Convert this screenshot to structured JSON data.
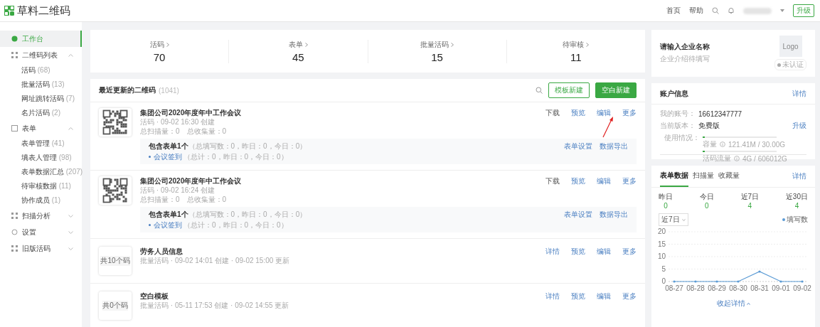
{
  "header": {
    "brand": "草料二维码",
    "nav": [
      "首页",
      "帮助"
    ],
    "upgrade": "升级"
  },
  "sidebar": {
    "items": [
      {
        "label": "工作台",
        "selected": true
      },
      {
        "label": "二维码列表",
        "selected": false,
        "expanded": true,
        "children": [
          {
            "label": "活码",
            "count": "(68)"
          },
          {
            "label": "批量活码",
            "count": "(13)"
          },
          {
            "label": "网址跳转活码",
            "count": "(7)"
          },
          {
            "label": "名片活码",
            "count": "(2)"
          }
        ]
      },
      {
        "label": "表单",
        "selected": false,
        "expanded": true,
        "children": [
          {
            "label": "表单管理",
            "count": "(41)"
          },
          {
            "label": "填表人管理",
            "count": "(98)"
          },
          {
            "label": "表单数据汇总",
            "count": "(207)"
          },
          {
            "label": "待审核数据",
            "count": "(11)"
          },
          {
            "label": "协作成员",
            "count": "(1)"
          }
        ]
      },
      {
        "label": "扫描分析",
        "selected": false,
        "expanded": false
      },
      {
        "label": "设置",
        "selected": false,
        "expanded": false
      },
      {
        "label": "旧版活码",
        "selected": false,
        "expanded": false
      }
    ]
  },
  "stats": [
    {
      "label": "活码",
      "value": "70"
    },
    {
      "label": "表单",
      "value": "45"
    },
    {
      "label": "批量活码",
      "value": "15"
    },
    {
      "label": "待审核",
      "value": "11"
    }
  ],
  "recent": {
    "title": "最近更新的二维码",
    "count": "(1041)",
    "buttons": [
      "模板新建",
      "空白新建"
    ],
    "items": [
      {
        "kind": "qr",
        "title": "集团公司2020年度年中工作会议",
        "meta": "活码 · 09-02 16:30 创建",
        "counts": "总扫描量：0　总收集量：0",
        "actions": [
          "下载",
          "预览",
          "编辑",
          "更多"
        ],
        "summary": {
          "heading": "包含表单1个",
          "stats": "（总填写数：0，昨日：0，今日：0）",
          "forms": [
            {
              "name": "会议签到",
              "stats": "（总计：0，昨日：0，今日：0）"
            }
          ],
          "actions": [
            "表单设置",
            "数据导出"
          ]
        }
      },
      {
        "kind": "qr",
        "title": "集团公司2020年度年中工作会议",
        "meta": "活码 · 09-02 16:24 创建",
        "counts": "总扫描量：0　总收集量：0",
        "actions": [
          "下载",
          "预览",
          "编辑",
          "更多"
        ],
        "summary": {
          "heading": "包含表单1个",
          "stats": "（总填写数：0，昨日：0，今日：0）",
          "forms": [
            {
              "name": "会议签到",
              "stats": "（总计：0，昨日：0，今日：0）"
            }
          ],
          "actions": [
            "表单设置",
            "数据导出"
          ]
        }
      },
      {
        "kind": "batch",
        "thumb": "共10个码",
        "title": "劳务人员信息",
        "meta": "批量活码 · 09-02 14:01 创建 · 09-02 15:00 更新",
        "actions": [
          "详情",
          "预览",
          "编辑",
          "更多"
        ]
      },
      {
        "kind": "batch",
        "thumb": "共0个码",
        "title": "空白模板",
        "meta": "批量活码 · 05-11 17:53 创建 · 09-02 14:55 更新",
        "actions": [
          "详情",
          "预览",
          "编辑",
          "更多"
        ]
      }
    ]
  },
  "company": {
    "name": "请输入企业名称",
    "intro": "企业介绍待填写",
    "logo": "Logo",
    "badge": "未认证"
  },
  "account": {
    "title": "账户信息",
    "link": "详情",
    "rows": [
      {
        "label": "我的账号：",
        "value": "16612347777"
      },
      {
        "label": "当前版本：",
        "value": "免费版",
        "action": "升级"
      }
    ],
    "usage_label": "使用情况：",
    "usage": [
      {
        "name": "容量",
        "reading": "121.41M / 30.00G",
        "level": 0.03
      },
      {
        "name": "活码流量",
        "reading": "4G / 606012G",
        "level": 0.03
      }
    ]
  },
  "data_card": {
    "tabs": [
      {
        "label": "表单数据",
        "selected": true
      },
      {
        "label": "扫描量",
        "selected": false
      },
      {
        "label": "收藏量",
        "selected": false
      }
    ],
    "link": "详情",
    "summary": [
      {
        "label": "昨日",
        "value": "0"
      },
      {
        "label": "今日",
        "value": "0"
      },
      {
        "label": "近7日",
        "value": "4"
      },
      {
        "label": "近30日",
        "value": "4"
      }
    ],
    "range": "近7日",
    "collapse": "收起详情",
    "chart_data": {
      "type": "line",
      "categories": [
        "08-27",
        "08-28",
        "08-29",
        "08-30",
        "08-31",
        "09-01",
        "09-02"
      ],
      "series": [
        {
          "name": "填写数",
          "color": "#5b9bd5",
          "values": [
            0,
            0,
            0,
            0,
            4,
            0,
            0
          ]
        }
      ],
      "ylim": [
        0,
        20
      ],
      "yticks": [
        0,
        5,
        10,
        15,
        20
      ],
      "grid": true
    }
  }
}
